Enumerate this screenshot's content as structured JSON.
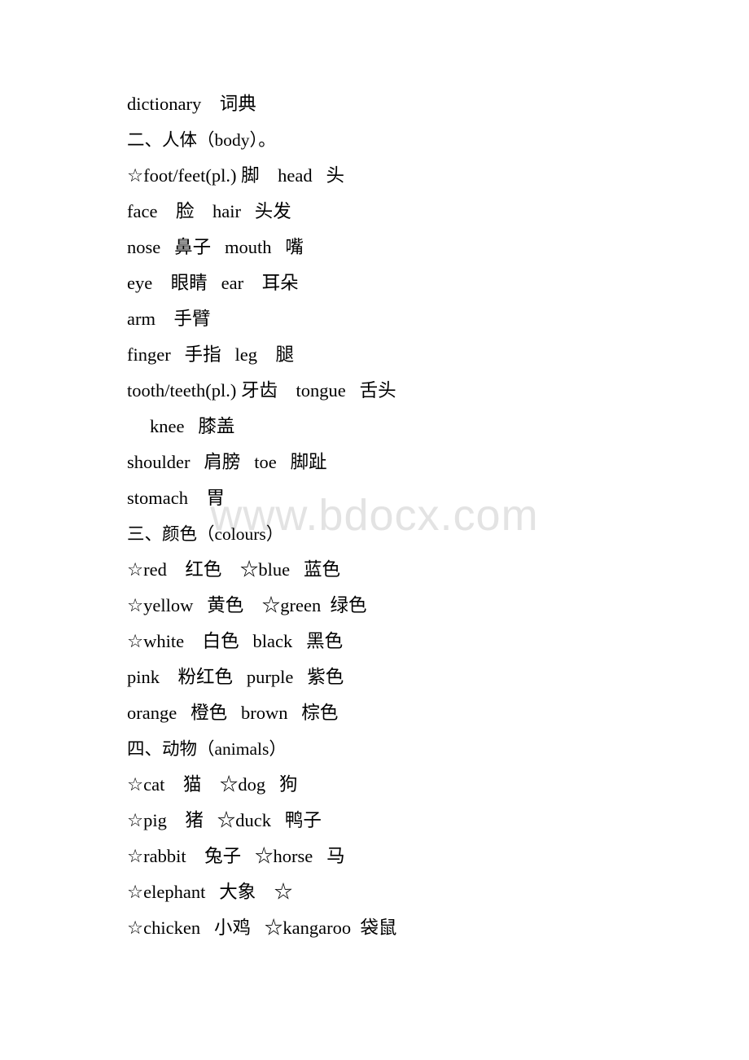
{
  "document": {
    "watermark": "www.bdocx.com",
    "watermark_color": "#e3e3e3",
    "background_color": "#ffffff",
    "text_color": "#000000",
    "star_marker": "☆"
  },
  "lines": [
    {
      "id": "l01",
      "text": "dictionary    词典",
      "kind": "entry"
    },
    {
      "id": "l02",
      "text": "二、人体（body）。",
      "kind": "heading"
    },
    {
      "id": "l03",
      "text": "☆foot/feet(pl.) 脚    head   头",
      "kind": "entry"
    },
    {
      "id": "l04",
      "text": "face    脸    hair   头发",
      "kind": "entry"
    },
    {
      "id": "l05",
      "text": "nose   鼻子   mouth   嘴",
      "kind": "entry"
    },
    {
      "id": "l06",
      "text": "eye    眼睛   ear    耳朵",
      "kind": "entry"
    },
    {
      "id": "l07",
      "text": "arm    手臂",
      "kind": "entry"
    },
    {
      "id": "l08",
      "text": "finger   手指   leg    腿",
      "kind": "entry"
    },
    {
      "id": "l09",
      "text": "tooth/teeth(pl.) 牙齿    tongue   舌头",
      "kind": "entry"
    },
    {
      "id": "l10",
      "text": "knee   膝盖",
      "kind": "entry-indent"
    },
    {
      "id": "l11",
      "text": "shoulder   肩膀   toe   脚趾",
      "kind": "entry"
    },
    {
      "id": "l12",
      "text": "stomach    胃",
      "kind": "entry"
    },
    {
      "id": "l13",
      "text": "三、颜色（colours）",
      "kind": "heading"
    },
    {
      "id": "l14",
      "text": "☆red    红色    ☆blue   蓝色",
      "kind": "entry"
    },
    {
      "id": "l15",
      "text": "☆yellow   黄色    ☆green  绿色",
      "kind": "entry"
    },
    {
      "id": "l16",
      "text": "☆white    白色   black   黑色",
      "kind": "entry"
    },
    {
      "id": "l17",
      "text": "pink    粉红色   purple   紫色",
      "kind": "entry"
    },
    {
      "id": "l18",
      "text": "orange   橙色   brown   棕色",
      "kind": "entry"
    },
    {
      "id": "l19",
      "text": "四、动物（animals）",
      "kind": "heading"
    },
    {
      "id": "l20",
      "text": "☆cat    猫    ☆dog   狗",
      "kind": "entry"
    },
    {
      "id": "l21",
      "text": "☆pig    猪   ☆duck   鸭子",
      "kind": "entry"
    },
    {
      "id": "l22",
      "text": "☆rabbit    兔子   ☆horse   马",
      "kind": "entry"
    },
    {
      "id": "l23",
      "text": "☆elephant   大象    ☆",
      "kind": "entry"
    },
    {
      "id": "l24",
      "text": "☆chicken   小鸡   ☆kangaroo  袋鼠",
      "kind": "entry"
    }
  ],
  "sections": [
    {
      "number": "二",
      "title_cn": "人体",
      "title_en": "body",
      "entries": [
        {
          "en": "foot/feet(pl.)",
          "cn": "脚",
          "starred": true
        },
        {
          "en": "head",
          "cn": "头",
          "starred": false
        },
        {
          "en": "face",
          "cn": "脸",
          "starred": false
        },
        {
          "en": "hair",
          "cn": "头发",
          "starred": false
        },
        {
          "en": "nose",
          "cn": "鼻子",
          "starred": false
        },
        {
          "en": "mouth",
          "cn": "嘴",
          "starred": false
        },
        {
          "en": "eye",
          "cn": "眼睛",
          "starred": false
        },
        {
          "en": "ear",
          "cn": "耳朵",
          "starred": false
        },
        {
          "en": "arm",
          "cn": "手臂",
          "starred": false
        },
        {
          "en": "finger",
          "cn": "手指",
          "starred": false
        },
        {
          "en": "leg",
          "cn": "腿",
          "starred": false
        },
        {
          "en": "tooth/teeth(pl.)",
          "cn": "牙齿",
          "starred": false
        },
        {
          "en": "tongue",
          "cn": "舌头",
          "starred": false
        },
        {
          "en": "knee",
          "cn": "膝盖",
          "starred": false
        },
        {
          "en": "shoulder",
          "cn": "肩膀",
          "starred": false
        },
        {
          "en": "toe",
          "cn": "脚趾",
          "starred": false
        },
        {
          "en": "stomach",
          "cn": "胃",
          "starred": false
        }
      ]
    },
    {
      "number": "三",
      "title_cn": "颜色",
      "title_en": "colours",
      "entries": [
        {
          "en": "red",
          "cn": "红色",
          "starred": true
        },
        {
          "en": "blue",
          "cn": "蓝色",
          "starred": true
        },
        {
          "en": "yellow",
          "cn": "黄色",
          "starred": true
        },
        {
          "en": "green",
          "cn": "绿色",
          "starred": true
        },
        {
          "en": "white",
          "cn": "白色",
          "starred": true
        },
        {
          "en": "black",
          "cn": "黑色",
          "starred": false
        },
        {
          "en": "pink",
          "cn": "粉红色",
          "starred": false
        },
        {
          "en": "purple",
          "cn": "紫色",
          "starred": false
        },
        {
          "en": "orange",
          "cn": "橙色",
          "starred": false
        },
        {
          "en": "brown",
          "cn": "棕色",
          "starred": false
        }
      ]
    },
    {
      "number": "四",
      "title_cn": "动物",
      "title_en": "animals",
      "entries": [
        {
          "en": "cat",
          "cn": "猫",
          "starred": true
        },
        {
          "en": "dog",
          "cn": "狗",
          "starred": true
        },
        {
          "en": "pig",
          "cn": "猪",
          "starred": true
        },
        {
          "en": "duck",
          "cn": "鸭子",
          "starred": true
        },
        {
          "en": "rabbit",
          "cn": "兔子",
          "starred": true
        },
        {
          "en": "horse",
          "cn": "马",
          "starred": true
        },
        {
          "en": "elephant",
          "cn": "大象",
          "starred": true
        },
        {
          "en": "chicken",
          "cn": "小鸡",
          "starred": true
        },
        {
          "en": "kangaroo",
          "cn": "袋鼠",
          "starred": true
        }
      ]
    }
  ]
}
